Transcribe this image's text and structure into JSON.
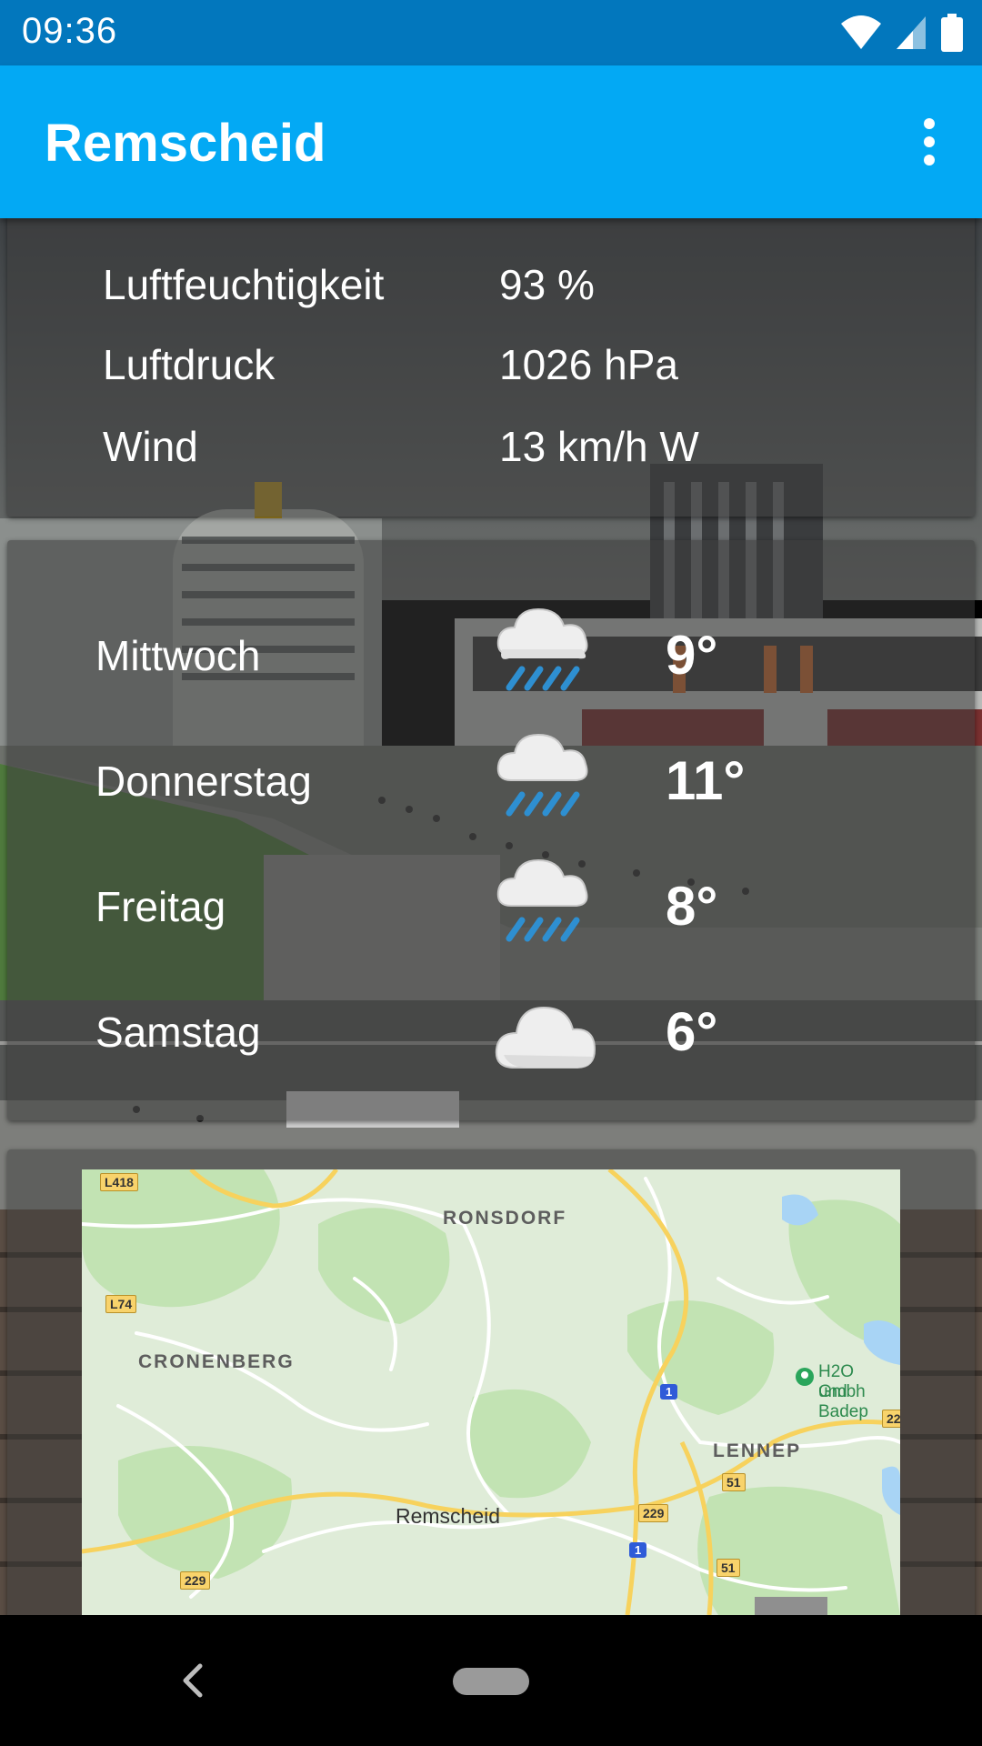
{
  "status_bar": {
    "time": "09:36"
  },
  "app_bar": {
    "title": "Remscheid",
    "menu_icon": "overflow-menu-icon"
  },
  "details": {
    "rows": [
      {
        "label": "Luftfeuchtigkeit",
        "value": "93 %"
      },
      {
        "label": "Luftdruck",
        "value": "1026 hPa"
      },
      {
        "label": "Wind",
        "value": "13 km/h W"
      }
    ]
  },
  "forecast": {
    "days": [
      {
        "day": "Mittwoch",
        "temp": "9°",
        "icon": "rain-cloud-icon"
      },
      {
        "day": "Donnerstag",
        "temp": "11°",
        "icon": "rain-cloud-icon"
      },
      {
        "day": "Freitag",
        "temp": "8°",
        "icon": "rain-cloud-icon"
      },
      {
        "day": "Samstag",
        "temp": "6°",
        "icon": "cloud-icon"
      }
    ]
  },
  "map": {
    "labels": {
      "ronsdorf": "RONSDORF",
      "cronenberg": "CRONENBERG",
      "lennep": "LENNEP",
      "remscheid": "Remscheid",
      "poi": "H2O Gmbh",
      "poi2": "und Badep"
    },
    "road_shields": [
      "L418",
      "L74",
      "229",
      "51",
      "229",
      "51",
      "1",
      "1",
      "22"
    ]
  },
  "colors": {
    "status_bar": "#0277bd",
    "app_bar": "#03a9f4",
    "card_overlay": "rgba(60,60,60,0.55)"
  }
}
